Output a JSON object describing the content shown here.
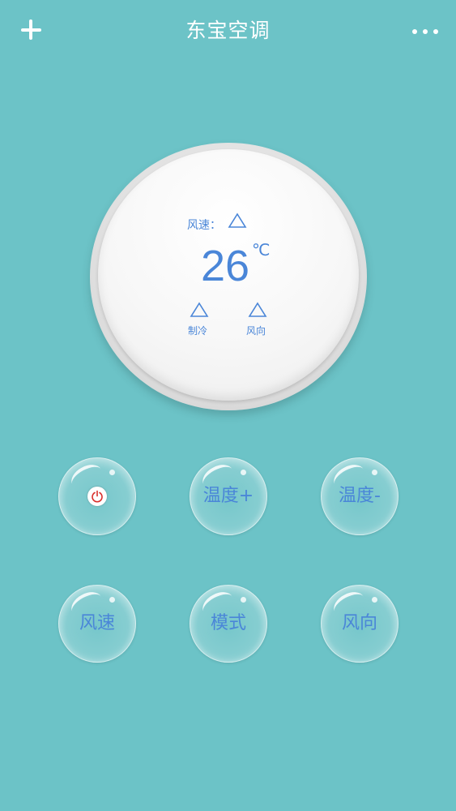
{
  "header": {
    "title": "东宝空调",
    "add_icon": "plus-icon",
    "more_icon": "more-dots-icon"
  },
  "display": {
    "fan_speed_label": "风速：",
    "temperature": "26",
    "unit": "℃",
    "mode_label": "制冷",
    "direction_label": "风向",
    "indicator_icon": "triangle-outline-icon"
  },
  "buttons": {
    "power_icon": "power-icon",
    "temp_up": "温度+",
    "temp_down": "温度-",
    "fan_speed": "风速",
    "mode": "模式",
    "direction": "风向"
  },
  "colors": {
    "background": "#6cc3c7",
    "text_accent": "#4a86d8",
    "power_red": "#d9302c"
  }
}
